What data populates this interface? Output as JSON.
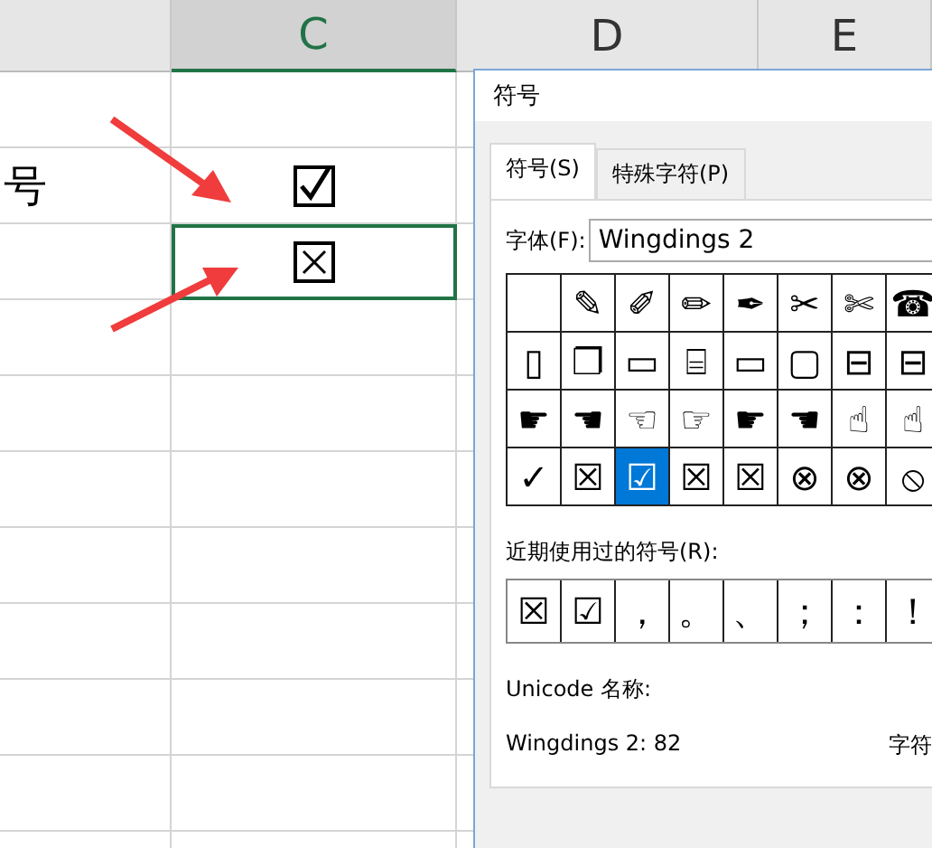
{
  "sheet": {
    "columns": [
      "C",
      "D",
      "E"
    ],
    "rows": [
      {
        "cells": [
          {},
          {
            "kind": "empty"
          }
        ]
      },
      {
        "cells": [
          {
            "text": "号"
          },
          {
            "kind": "check"
          }
        ]
      },
      {
        "cells": [
          {},
          {
            "kind": "cross",
            "selected": true
          }
        ]
      },
      {
        "cells": [
          {},
          {
            "kind": "empty"
          }
        ]
      }
    ]
  },
  "dialog": {
    "title": "符号",
    "tabs": [
      {
        "label": "符号(S)",
        "selected": true
      },
      {
        "label": "特殊字符(P)",
        "selected": false
      }
    ],
    "font_label": "字体(F):",
    "font_value": "Wingdings 2",
    "symbols": [
      {
        "selected": false
      },
      {
        "glyph": "✎",
        "selected": false
      },
      {
        "glyph": "✐",
        "selected": false
      },
      {
        "glyph": "✏",
        "selected": false
      },
      {
        "glyph": "✒",
        "selected": false
      },
      {
        "glyph": "✂",
        "selected": false
      },
      {
        "glyph": "✄",
        "selected": false
      },
      {
        "glyph": "☎",
        "selected": false
      },
      {
        "glyph": "▯",
        "selected": false
      },
      {
        "glyph": "❐",
        "selected": false
      },
      {
        "glyph": "▭",
        "selected": false
      },
      {
        "glyph": "⌸",
        "selected": false
      },
      {
        "glyph": "▭",
        "selected": false
      },
      {
        "glyph": "▢",
        "selected": false
      },
      {
        "glyph": "⊟",
        "selected": false
      },
      {
        "glyph": "⊟",
        "selected": false
      },
      {
        "glyph": "☛",
        "selected": false
      },
      {
        "glyph": "☚",
        "selected": false
      },
      {
        "glyph": "☜",
        "selected": false
      },
      {
        "glyph": "☞",
        "selected": false
      },
      {
        "glyph": "☛",
        "selected": false
      },
      {
        "glyph": "☚",
        "selected": false
      },
      {
        "glyph": "☝",
        "selected": false
      },
      {
        "glyph": "☝",
        "selected": false
      },
      {
        "glyph": "✓",
        "selected": false
      },
      {
        "glyph": "☒",
        "selected": false
      },
      {
        "glyph": "☑",
        "selected": true
      },
      {
        "glyph": "☒",
        "selected": false
      },
      {
        "glyph": "☒",
        "selected": false
      },
      {
        "glyph": "⊗",
        "selected": false
      },
      {
        "glyph": "⊗",
        "selected": false
      },
      {
        "glyph": "⦸",
        "selected": false
      }
    ],
    "recent_label": "近期使用过的符号(R):",
    "recent": [
      "☒",
      "☑",
      "，",
      "。",
      "、",
      "；",
      "：",
      "！"
    ],
    "unicode_label": "Unicode 名称:",
    "char_code": "Wingdings 2: 82",
    "charcode_label": "字符"
  }
}
